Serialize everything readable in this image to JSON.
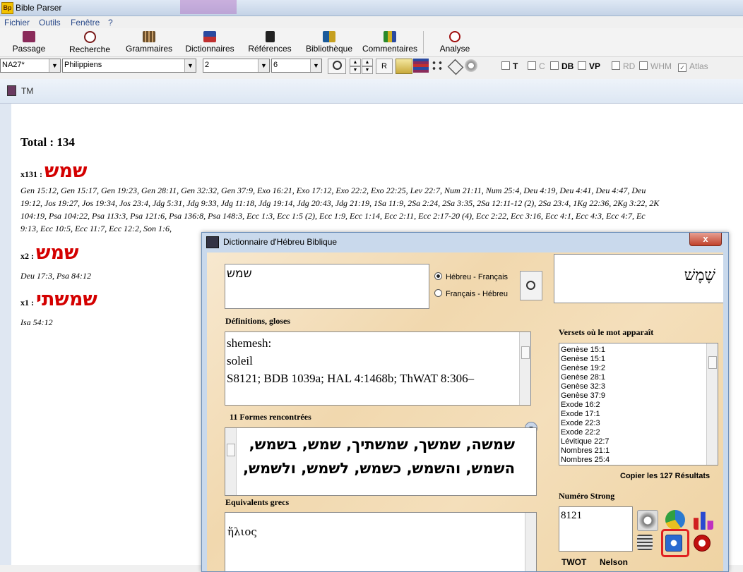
{
  "window": {
    "title": "Bible Parser",
    "logo_text": "Bp"
  },
  "menu": [
    "Fichier",
    "Outils",
    "Fenêtre",
    "?"
  ],
  "toolbar": [
    {
      "label": "Passage",
      "icon": "book-icon",
      "color": "#8a2b5a"
    },
    {
      "label": "Recherche",
      "icon": "magnifier-icon",
      "color": "#7a1a1a"
    },
    {
      "label": "Grammaires",
      "icon": "books-shelf-icon",
      "color": "#6b4e2a"
    },
    {
      "label": "Dictionnaires",
      "icon": "dictionary-icon",
      "color": "#2a4aa0"
    },
    {
      "label": "Références",
      "icon": "reference-book-icon",
      "color": "#222222"
    },
    {
      "label": "Bibliothèque",
      "icon": "library-icon",
      "color": "#1a5a9a"
    },
    {
      "label": "Commentaires",
      "icon": "commentary-books-icon",
      "color": "#2a8a2a"
    },
    {
      "label": "Analyse",
      "icon": "analysis-icon",
      "color": "#a01010"
    }
  ],
  "selectors": {
    "version": "NA27*",
    "book": "Philippiens",
    "chapter": "2",
    "verse": "6"
  },
  "small_buttons": {
    "r_label": "R"
  },
  "checkboxes": [
    {
      "label": "T",
      "checked": false,
      "enabled": true
    },
    {
      "label": "C",
      "checked": false,
      "enabled": false
    },
    {
      "label": "DB",
      "checked": false,
      "enabled": true
    },
    {
      "label": "VP",
      "checked": false,
      "enabled": true
    },
    {
      "label": "RD",
      "checked": false,
      "enabled": false
    },
    {
      "label": "WHM",
      "checked": false,
      "enabled": false
    },
    {
      "label": "Atlas",
      "checked": true,
      "enabled": false
    }
  ],
  "tm": {
    "title": "TM",
    "total": "Total : 134",
    "groups": [
      {
        "count": "x131 :",
        "word": "שמש",
        "refs": [
          "Gen 15:12, Gen 15:17, Gen 19:23, Gen 28:11, Gen 32:32, Gen 37:9, Exo 16:21, Exo 17:12, Exo 22:2, Exo 22:25, Lev 22:7, Num 21:11, Num 25:4, Deu 4:19, Deu 4:41, Deu 4:47, Deu",
          "19:12, Jos 19:27, Jos 19:34, Jos 23:4, Jdg 5:31, Jdg 9:33, Jdg 11:18, Jdg 19:14, Jdg 20:43, Jdg 21:19, 1Sa 11:9, 2Sa 2:24, 2Sa 3:35, 2Sa 12:11-12 (2), 2Sa 23:4, 1Kg 22:36, 2Kg 3:22, 2K",
          "104:19, Psa 104:22, Psa 113:3, Psa 121:6, Psa 136:8, Psa 148:3, Ecc 1:3, Ecc 1:5 (2), Ecc 1:9, Ecc 1:14, Ecc 2:11, Ecc 2:17-20 (4), Ecc 2:22, Ecc 3:16, Ecc 4:1, Ecc 4:3, Ecc 4:7, Ec",
          "9:13, Ecc 10:5, Ecc 11:7, Ecc 12:2, Son 1:6,"
        ]
      },
      {
        "count": "x2 :",
        "word": "שמש",
        "refs": [
          "Deu 17:3, Psa 84:12"
        ]
      },
      {
        "count": "x1 :",
        "word": "שמשתי",
        "refs": [
          "Isa 54:12"
        ]
      }
    ]
  },
  "dialog": {
    "title": "Dictionnaire d'Hébreu Biblique",
    "close_label": "x",
    "search_value": "שמש",
    "radio_heb_fr": "Hébreu - Français",
    "radio_fr_heb": "Français - Hébreu",
    "pointed_word": "שֶׁמֶשׁ",
    "def_label": "Définitions, gloses",
    "definitions": [
      "shemesh:",
      "soleil",
      "S8121; BDB 1039a; HAL 4:1468b; ThWAT 8:306–"
    ],
    "forms_label": "11 Formes rencontrées",
    "forms_lines": [
      "שמשה, שמשך, שמשתיך, שמש, בשמש,",
      "השמש, והשמש, כשמש, לשמש, ולשמש,"
    ],
    "greek_label": "Equivalents grecs",
    "greek_value": "ἥλιος",
    "verses_label": "Versets où le mot apparaît",
    "verses": [
      "Genèse 15:1",
      "Genèse 15:1",
      "Genèse 19:2",
      "Genèse 28:1",
      "Genèse 32:3",
      "Genèse 37:9",
      "Exode 16:2",
      "Exode 17:1",
      "Exode 22:3",
      "Exode 22:2",
      "Lévitique 22:7",
      "Nombres 21:1",
      "Nombres 25:4"
    ],
    "copy_label": "Copier les 127 Résultats",
    "strong_label": "Numéro Strong",
    "strong_value": "8121",
    "bottom_labels": [
      "TWOT",
      "Nelson"
    ],
    "highlight_color": "#e02020"
  }
}
